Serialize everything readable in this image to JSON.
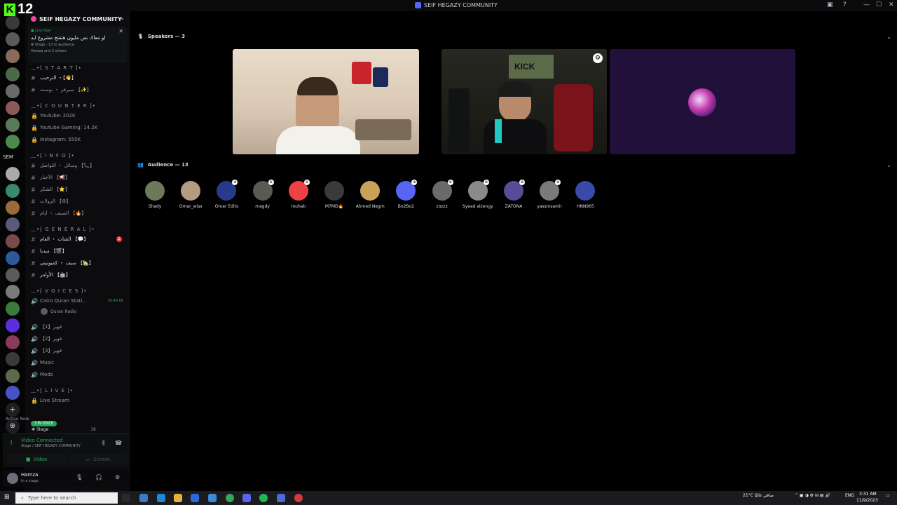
{
  "overlay": {
    "number": "12"
  },
  "window": {
    "title": "SEIF HEGAZY COMMUNITY"
  },
  "rail": {
    "label": "SEM"
  },
  "server": {
    "name": "SEIF HEGAZY COMMUNITY"
  },
  "live_event": {
    "status": "Live Now",
    "title": "لو معاك نص مليون هتفتح مشروع ايه",
    "meta": "Stage · 13 in audience",
    "people": "Hamza and 2 others"
  },
  "categories": {
    "start": "﹏•[ S T A R T ]•",
    "counter": "﹏•[ C O U N T E R ]•",
    "info": "﹏•[ I N F O ]•",
    "general": "﹏•[ G E N E R A L ]•",
    "voices": "﹏•[ V O I C E S ]•",
    "live": "﹏•[ L I V E ]•"
  },
  "channels": {
    "welcome": "الترحيب ・【👋】",
    "server_boost": "سيرفر ・ بوست 【✨】",
    "youtube": "Youtube: 202K",
    "youtube_gaming": "Youtube Gaming: 14.2K",
    "instagram": "Instagram: 555K",
    "contact": "وسائل ・ التواصل 【📞】",
    "news": "الأخبار 【📢】",
    "thanks": "الشكر 【⭐】",
    "roles": "الرولات 【⚙】",
    "summer": "الصيف ・ ايام 【🔥】",
    "chat": "الشات ・ العام 【💬】",
    "media": "ميديا 【🎬】",
    "community": "سيف ・ كميونيتي 【🏡】",
    "commands": "الأوامر 【🤖】",
    "quran": "Cairo Quran Stati...",
    "quran_time": "30:49:06",
    "quran_user": "Quran Radio",
    "voice1": "【1】فويز",
    "voice2": "【2】فويز",
    "voice3": "【3】فويز",
    "music": "Music",
    "mods": "Mods",
    "live_stream": "Live Stream",
    "mention_count": "1"
  },
  "active_now": {
    "label": "Active Now",
    "pill": "3 IN VOICE",
    "stage": "Stage",
    "count": "16"
  },
  "voice": {
    "status": "Video Connected",
    "location": "Stage / SEIF HEGAZY COMMUNITY",
    "video_btn": "Video",
    "screen_btn": "Screen"
  },
  "user": {
    "name": "Hamza",
    "status": "In a stage"
  },
  "speakers": {
    "header": "Speakers — 3",
    "tile2_banner": "KICK"
  },
  "audience": {
    "header": "Audience — 13",
    "members": [
      {
        "name": "Shady",
        "color": "#6b7a5a"
      },
      {
        "name": "Omar_wiss",
        "color": "#b69a82"
      },
      {
        "name": "Omar Edits",
        "color": "#2a3a8a"
      },
      {
        "name": "magdy",
        "color": "#5a5a52"
      },
      {
        "name": "muhab",
        "color": "#ed4245"
      },
      {
        "name": "M7MD🔥",
        "color": "#3a3a3a"
      },
      {
        "name": "Ahmed Negm",
        "color": "#c9a25a"
      },
      {
        "name": "Bo2Bo2",
        "color": "#5865f2"
      },
      {
        "name": "zozzz",
        "color": "#6a6a6a"
      },
      {
        "name": "Syead alzengy",
        "color": "#8a8a8a"
      },
      {
        "name": "ZATONA",
        "color": "#5a4a9a"
      },
      {
        "name": "yassinsamir",
        "color": "#7a7a7a"
      },
      {
        "name": "HNN965",
        "color": "#3a4aa8"
      }
    ]
  },
  "taskbar": {
    "search_placeholder": "Type here to search",
    "weather": "21°C  صافي غالبًا",
    "lang": "ENG",
    "time": "3:31 AM",
    "date": "11/9/2023"
  }
}
